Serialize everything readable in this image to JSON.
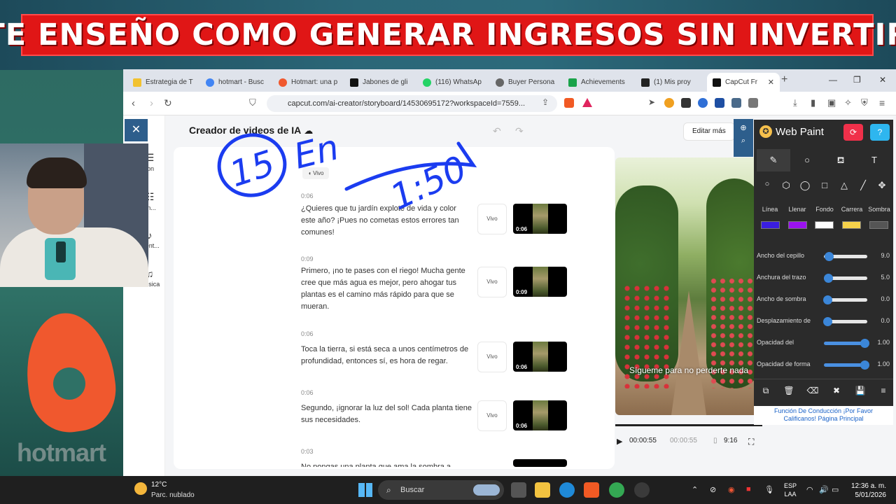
{
  "banner": {
    "text": "TE ENSEÑO COMO GENERAR INGRESOS SIN INVERTIR"
  },
  "browser": {
    "tabs": [
      {
        "label": "Estrategia de T",
        "color": "#f2c230",
        "active": false
      },
      {
        "label": "hotmart - Busc",
        "color": "#4285f4",
        "active": false
      },
      {
        "label": "Hotmart: una p",
        "color": "#f0582e",
        "active": false
      },
      {
        "label": "Jabones de gli",
        "color": "#111111",
        "active": false
      },
      {
        "label": "(116) WhatsAp",
        "color": "#25d366",
        "active": false
      },
      {
        "label": "Buyer Persona",
        "color": "#666666",
        "active": false
      },
      {
        "label": "Achievements",
        "color": "#1aa34a",
        "active": false
      },
      {
        "label": "(1) Mis proy",
        "color": "#222222",
        "active": false
      },
      {
        "label": "CapCut Fr",
        "color": "#111111",
        "active": true
      }
    ],
    "url": "capcut.com/ai-creator/storyboard/14530695172?workspaceId=7559..."
  },
  "app": {
    "title": "Creador de videos de IA",
    "edit_more": "Editar más",
    "vivo_top": "Vivo",
    "rail": [
      {
        "label": "ion",
        "icon": "☰"
      },
      {
        "label": "en...",
        "icon": "☷"
      },
      {
        "label": "ment...",
        "icon": "♪"
      },
      {
        "label": "Música",
        "icon": "♫"
      }
    ],
    "scenes": [
      {
        "time": "0:06",
        "text": "¿Quieres que tu jardín explote de vida y color este año? ¡Pues no cometas estos errores tan comunes!",
        "vivo": "Vivo",
        "duration": "0:06"
      },
      {
        "time": "0:09",
        "text": "Primero, ¡no te pases con el riego! Mucha gente cree que más agua es mejor, pero ahogar tus plantas es el camino más rápido para que se mueran.",
        "vivo": "Vivo",
        "duration": "0:09"
      },
      {
        "time": "0:06",
        "text": "Toca la tierra, si está seca a unos centímetros de profundidad, entonces sí, es hora de regar.",
        "vivo": "Vivo",
        "duration": "0:06"
      },
      {
        "time": "0:06",
        "text": "Segundo, ¡ignorar la luz del sol! Cada planta tiene sus necesidades.",
        "vivo": "Vivo",
        "duration": "0:06"
      },
      {
        "time": "0:03",
        "text": "No pongas una planta que ama la sombra a",
        "vivo": "",
        "duration": ""
      }
    ],
    "preview_caption": "Sígueme para no perderte nada",
    "player": {
      "current": "00:00:55",
      "total": "00:00:55",
      "ratio": "9:16"
    }
  },
  "webpaint": {
    "title": "Web Paint",
    "color_labels": [
      "Línea",
      "Llenar",
      "Fondo",
      "Carrera",
      "Sombra"
    ],
    "colors": [
      "#3a1ee0",
      "#9b12f0",
      "#ffffff",
      "#f6d24a",
      "#555555"
    ],
    "sliders": [
      {
        "label": "Ancho del cepillo",
        "value": "9.0",
        "fill": 0.1
      },
      {
        "label": "Anchura del trazo",
        "value": "5.0",
        "fill": 0.05
      },
      {
        "label": "Ancho de sombra",
        "value": "0.0",
        "fill": 0.0
      },
      {
        "label": "Desplazamiento de",
        "value": "0.0",
        "fill": 0.0
      },
      {
        "label": "Opacidad del",
        "value": "1.00",
        "fill": 1.0
      },
      {
        "label": "Opacidad de forma",
        "value": "1.00",
        "fill": 1.0
      }
    ],
    "footer_line1": "Función De Conducción ¡Por Favor",
    "footer_line2": "Calificanos! Página Principal"
  },
  "taskbar": {
    "temp": "12°C",
    "weather": "Parc. nublado",
    "search": "Buscar",
    "lang1": "ESP",
    "lang2": "LAA",
    "time": "12:36 a. m.",
    "date": "5/01/2026"
  },
  "logo_text": "hotmart",
  "ink": {
    "color": "#1b3cf0",
    "text1": "15",
    "text2": "En",
    "text3": "1:50"
  }
}
